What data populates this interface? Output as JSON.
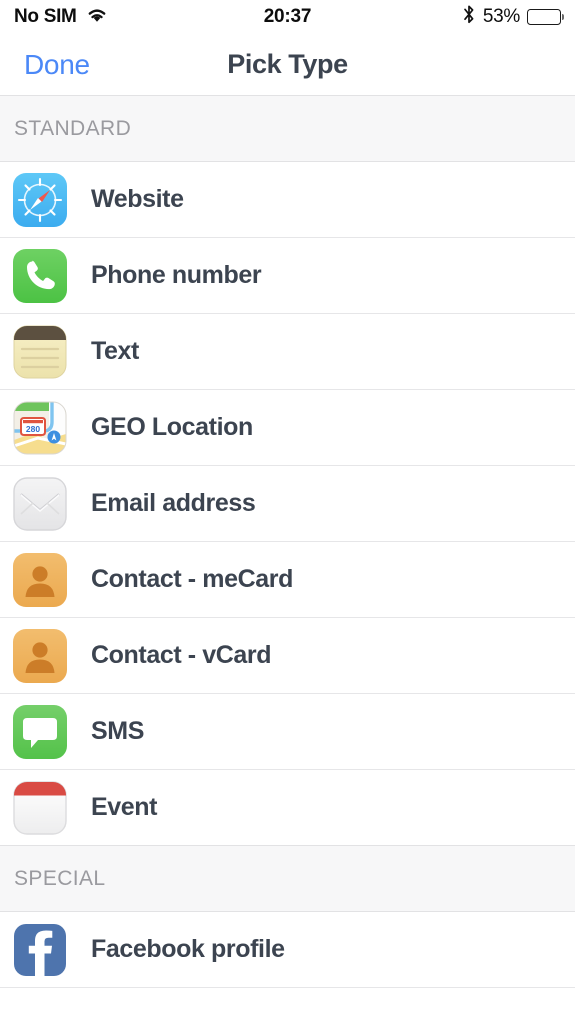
{
  "status_bar": {
    "carrier": "No SIM",
    "wifi_icon": "wifi-icon",
    "time": "20:37",
    "bluetooth_icon": "bluetooth-icon",
    "battery_percent": "53%",
    "battery_level": 53
  },
  "nav_bar": {
    "done_label": "Done",
    "title": "Pick Type",
    "done_color": "#4b88f7",
    "title_color": "#3c4450"
  },
  "sections": [
    {
      "header": "STANDARD",
      "rows": [
        {
          "label": "Website",
          "icon": "safari-icon"
        },
        {
          "label": "Phone number",
          "icon": "phone-icon"
        },
        {
          "label": "Text",
          "icon": "notes-icon"
        },
        {
          "label": "GEO Location",
          "icon": "maps-icon"
        },
        {
          "label": "Email address",
          "icon": "mail-icon"
        },
        {
          "label": "Contact - meCard",
          "icon": "contact-icon"
        },
        {
          "label": "Contact - vCard",
          "icon": "contact-icon"
        },
        {
          "label": "SMS",
          "icon": "messages-icon"
        },
        {
          "label": "Event",
          "icon": "calendar-icon"
        }
      ]
    },
    {
      "header": "SPECIAL",
      "rows": [
        {
          "label": "Facebook profile",
          "icon": "facebook-icon"
        }
      ]
    }
  ]
}
